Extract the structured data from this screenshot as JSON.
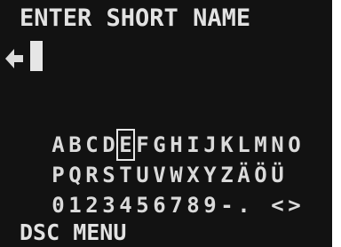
{
  "screen": {
    "title": "ENTER SHORT NAME",
    "input_value": "",
    "menu_label": "DSC MENU",
    "selected_char": "E",
    "rows": [
      [
        "A",
        "B",
        "C",
        "D",
        "E",
        "F",
        "G",
        "H",
        "I",
        "J",
        "K",
        "L",
        "M",
        "N",
        "O"
      ],
      [
        "P",
        "Q",
        "R",
        "S",
        "T",
        "U",
        "V",
        "W",
        "X",
        "Y",
        "Z",
        "Ä",
        "Ö",
        "Ü"
      ],
      [
        "0",
        "1",
        "2",
        "3",
        "4",
        "5",
        "6",
        "7",
        "8",
        "9",
        "-",
        ".",
        " ",
        "<",
        ">"
      ]
    ]
  },
  "colors": {
    "background": "#121212",
    "text": "#dcdcdc"
  }
}
